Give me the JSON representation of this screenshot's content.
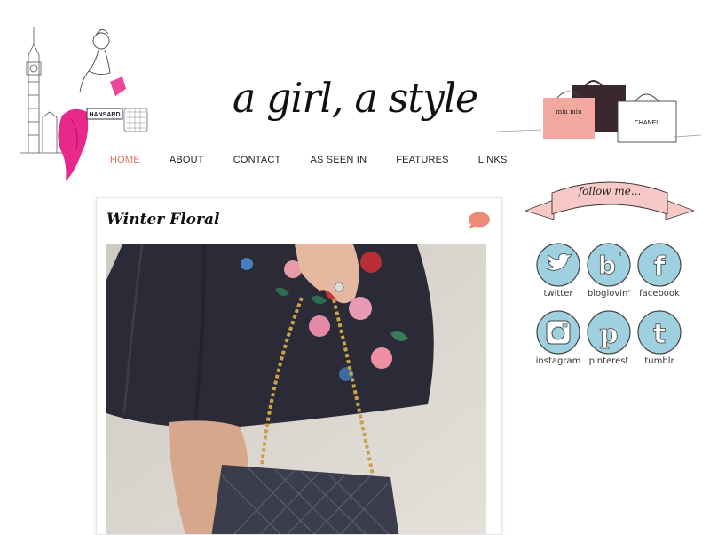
{
  "header": {
    "logo_text": "a girl, a style",
    "left_illustration_sign": "HANSARD",
    "right_illustration_bags": [
      "miu miu",
      "CHANEL"
    ]
  },
  "nav": {
    "items": [
      {
        "label": "HOME",
        "active": true
      },
      {
        "label": "ABOUT",
        "active": false
      },
      {
        "label": "CONTACT",
        "active": false
      },
      {
        "label": "AS SEEN IN",
        "active": false
      },
      {
        "label": "FEATURES",
        "active": false
      },
      {
        "label": "LINKS",
        "active": false
      }
    ]
  },
  "post": {
    "title": "Winter Floral"
  },
  "sidebar": {
    "follow_text": "follow me...",
    "social": [
      {
        "label": "twitter",
        "icon": "twitter-icon"
      },
      {
        "label": "bloglovin'",
        "icon": "bloglovin-icon"
      },
      {
        "label": "facebook",
        "icon": "facebook-icon"
      },
      {
        "label": "instagram",
        "icon": "instagram-icon"
      },
      {
        "label": "pinterest",
        "icon": "pinterest-icon"
      },
      {
        "label": "tumblr",
        "icon": "tumblr-icon"
      }
    ]
  },
  "colors": {
    "accent": "#e0705b",
    "social_circle": "#9fd0e0",
    "banner_pink": "#f6c9c6"
  }
}
